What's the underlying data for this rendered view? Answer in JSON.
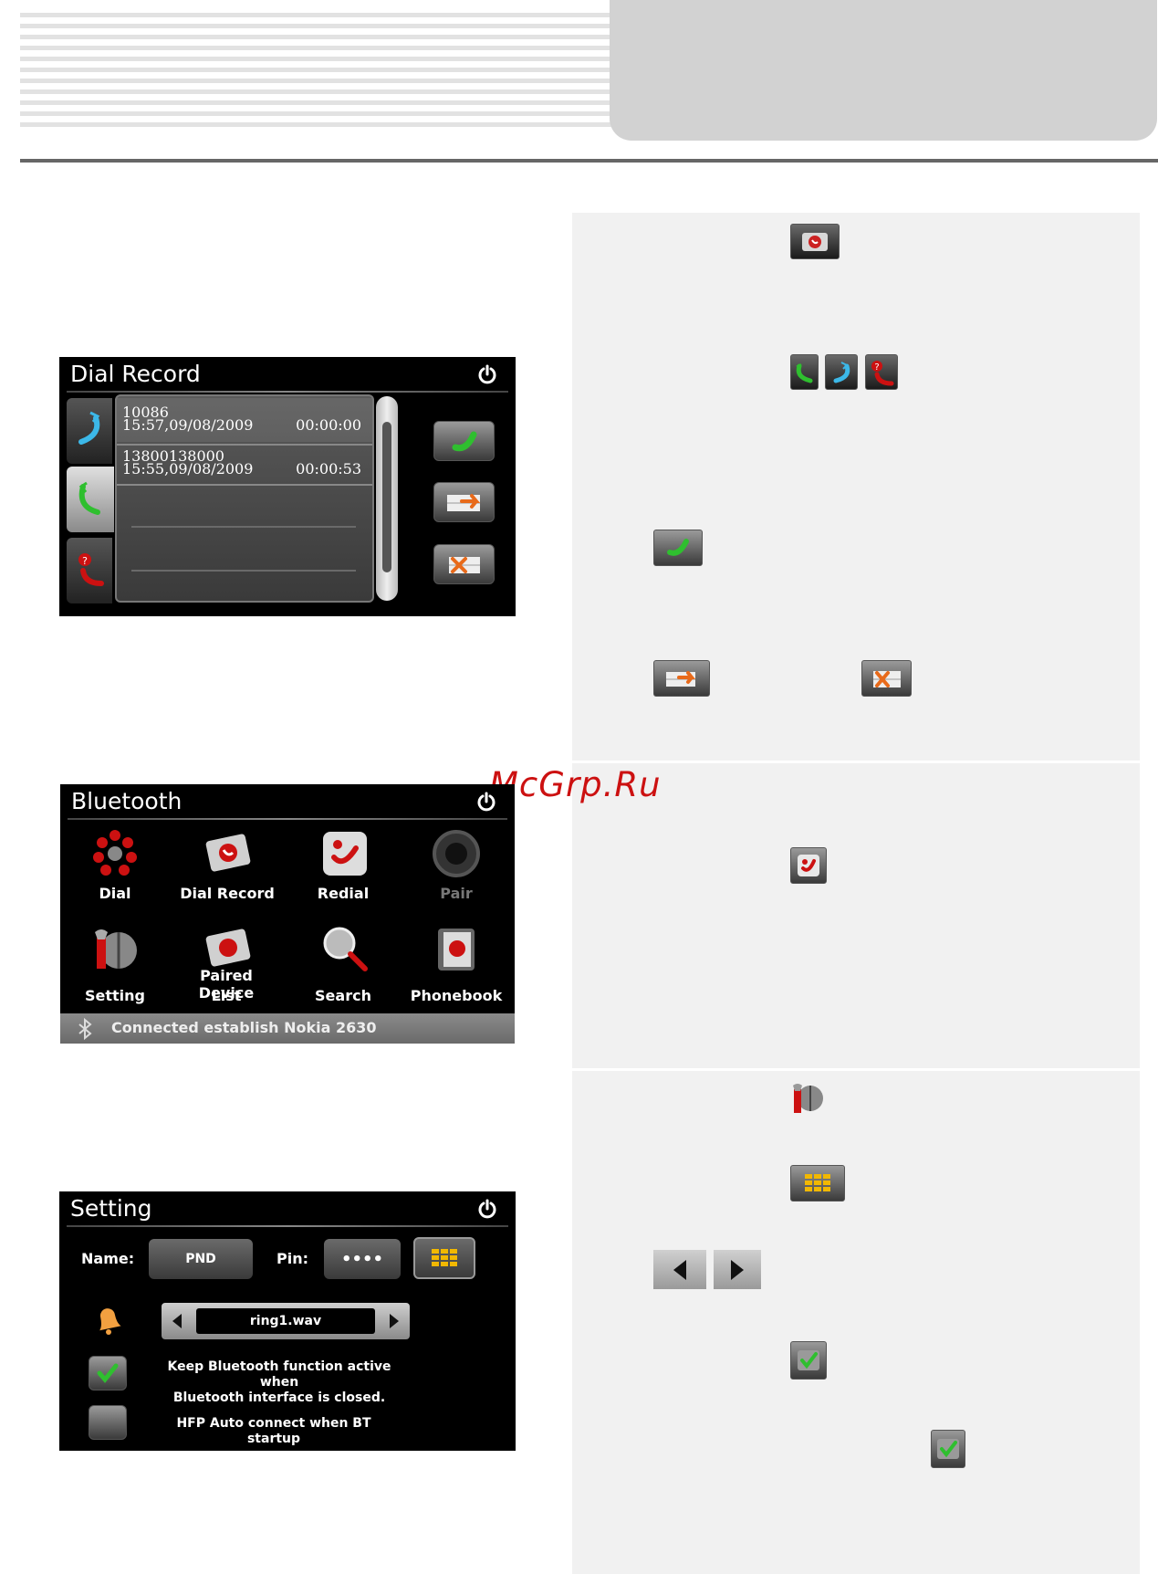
{
  "watermark": "McGrp.Ru",
  "dial_record_screen": {
    "title": "Dial Record",
    "records": [
      {
        "number": "10086",
        "datetime": "15:57,09/08/2009",
        "duration": "00:00:00"
      },
      {
        "number": "13800138000",
        "datetime": "15:55,09/08/2009",
        "duration": "00:00:53"
      }
    ]
  },
  "bluetooth_screen": {
    "title": "Bluetooth",
    "items": [
      {
        "label": "Dial",
        "icon": "dial-icon"
      },
      {
        "label": "Dial Record",
        "icon": "dial-record-icon"
      },
      {
        "label": "Redial",
        "icon": "redial-icon"
      },
      {
        "label": "Pair",
        "icon": "pair-icon"
      },
      {
        "label": "Setting",
        "icon": "setting-icon"
      },
      {
        "label": "Paired Device",
        "label2": "List",
        "icon": "paired-device-icon"
      },
      {
        "label": "Search",
        "icon": "search-icon"
      },
      {
        "label": "Phonebook",
        "icon": "phonebook-icon"
      }
    ],
    "status": "Connected establish Nokia 2630"
  },
  "setting_screen": {
    "title": "Setting",
    "name_label": "Name:",
    "name_value": "PND",
    "pin_label": "Pin:",
    "pin_value": "••••",
    "ringtone": "ring1.wav",
    "option1": "Keep Bluetooth function active when Bluetooth interface is closed.",
    "option1_line1": "Keep Bluetooth function active when",
    "option1_line2": "Bluetooth interface is closed.",
    "option1_checked": true,
    "option2": "HFP Auto connect when BT startup",
    "option2_checked": false
  },
  "colors": {
    "accent_green": "#2fbf2f",
    "alert_red": "#cc1111",
    "keypad_yellow": "#f2b800"
  }
}
